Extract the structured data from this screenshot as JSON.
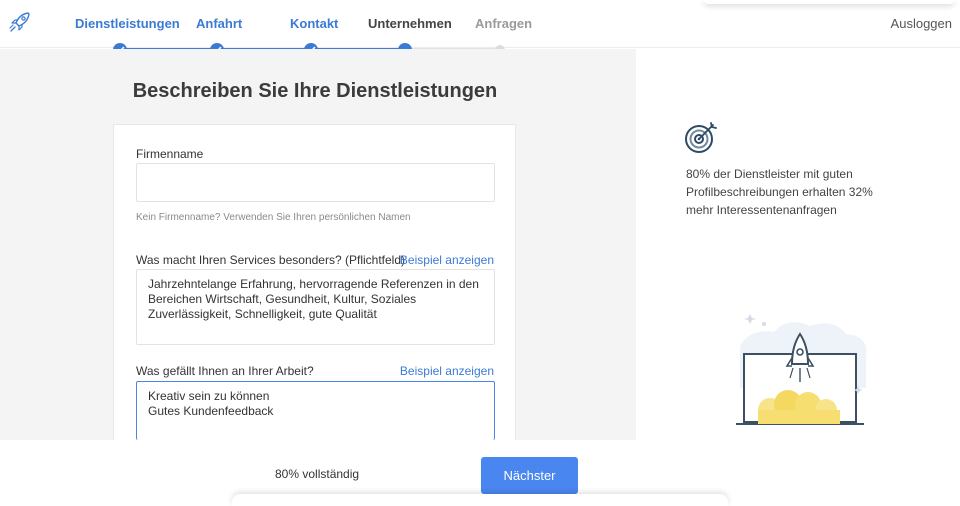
{
  "header": {
    "logo_icon": "rocket-logo-icon",
    "steps": [
      {
        "label": "Dienstleistungen",
        "state": "done"
      },
      {
        "label": "Anfahrt",
        "state": "done"
      },
      {
        "label": "Kontakt",
        "state": "done"
      },
      {
        "label": "Unternehmen",
        "state": "current"
      },
      {
        "label": "Anfragen",
        "state": "todo"
      }
    ],
    "logout": "Ausloggen"
  },
  "form": {
    "title": "Beschreiben Sie Ihre Dienstleistungen",
    "company_label": "Firmenname",
    "company_value": "",
    "company_hint": "Kein Firmenname? Verwenden Sie Ihren persönlichen Namen",
    "special_label": "Was macht Ihren Services besonders? (Pflichtfeld)",
    "special_example": "Beispiel anzeigen",
    "special_lines": [
      "Jahrzehntelange Erfahrung, hervorragende Referenzen in den",
      "Bereichen Wirtschaft, Gesundheit, Kultur, Soziales",
      "Zuverlässigkeit, Schnelligkeit, gute Qualität"
    ],
    "like_label": "Was gefällt Ihnen an Ihrer Arbeit?",
    "like_example": "Beispiel anzeigen",
    "like_lines": [
      "Kreativ sein zu können",
      "Gutes Kundenfeedback"
    ]
  },
  "side": {
    "icon": "target-icon",
    "text": "80% der Dienstleister mit guten Profilbeschreibungen erhalten 32% mehr Interessentenanfragen",
    "illustration": "rocket-launch-illustration"
  },
  "footer": {
    "progress_text": "80% vollständig",
    "progress_value": 0.8,
    "next_label": "Nächster"
  },
  "colors": {
    "accent": "#3a7bd5",
    "button": "#4a86f0",
    "background": "#f4f4f5"
  }
}
